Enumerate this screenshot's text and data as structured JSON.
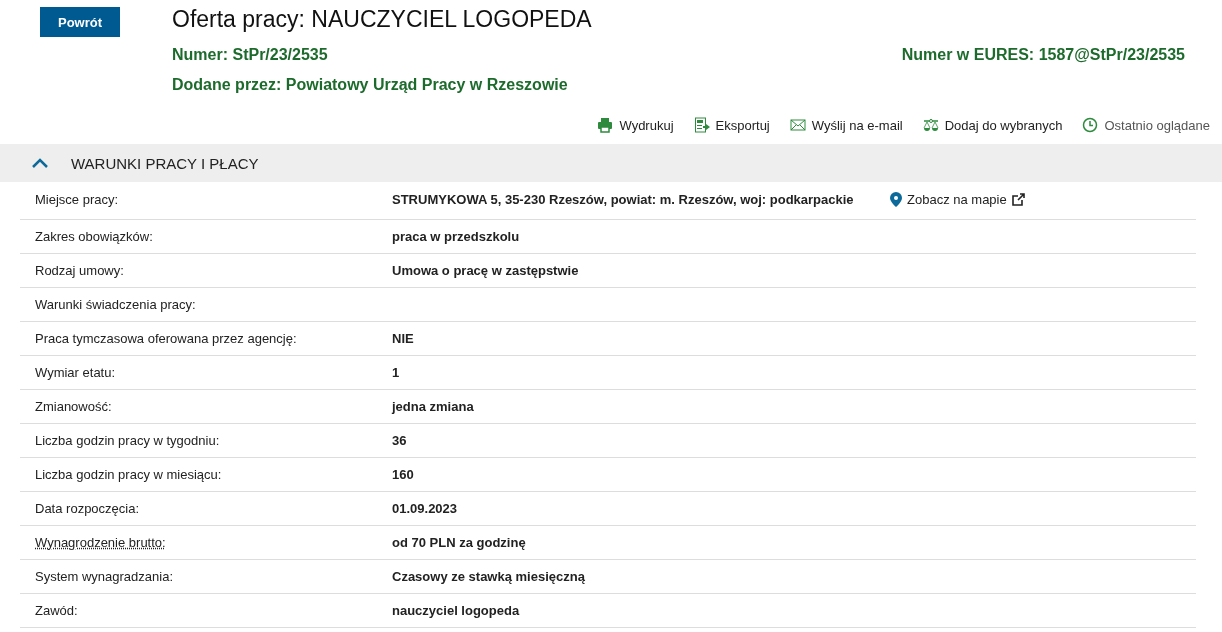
{
  "back_button": "Powrót",
  "title": "Oferta pracy: NAUCZYCIEL LOGOPEDA",
  "number": {
    "label": "Numer:",
    "value": "StPr/23/2535"
  },
  "eures_number": {
    "label": "Numer w EURES:",
    "value": "1587@StPr/23/2535"
  },
  "added_by": {
    "label": "Dodane przez:",
    "value": "Powiatowy Urząd Pracy w Rzeszowie"
  },
  "actions": [
    {
      "kind": "print",
      "label": "Wydrukuj"
    },
    {
      "kind": "pdf",
      "label": "Eksportuj"
    },
    {
      "kind": "mail",
      "label": "Wyślij na e-mail"
    },
    {
      "kind": "favorite",
      "label": "Dodaj do wybranych"
    },
    {
      "kind": "history",
      "label": "Ostatnio oglądane"
    }
  ],
  "section": {
    "title": "WARUNKI PRACY I PŁACY",
    "expanded": true,
    "rows": [
      {
        "label": "Miejsce pracy:",
        "value": "STRUMYKOWA 5, 35-230 Rzeszów, powiat: m. Rzeszów, woj: podkarpackie",
        "link": "Zobacz na mapie"
      },
      {
        "label": "Zakres obowiązków:",
        "value": "praca w przedszkolu"
      },
      {
        "label": "Rodzaj umowy:",
        "value": "Umowa o pracę w zastępstwie"
      },
      {
        "label": "Warunki świadczenia pracy:"
      },
      {
        "label": "Praca tymczasowa oferowana przez agencję:",
        "value": "NIE"
      },
      {
        "label": "Wymiar etatu:",
        "value": "1"
      },
      {
        "label": "Zmianowość:",
        "value": "jedna zmiana"
      },
      {
        "label": "Liczba godzin pracy w tygodniu:",
        "value": "36"
      },
      {
        "label": "Liczba godzin pracy w miesiącu:",
        "value": "160"
      },
      {
        "label": "Data rozpoczęcia:",
        "value": "01.09.2023"
      },
      {
        "label": "Wynagrodzenie brutto:",
        "value": "od 70 PLN za godzinę",
        "hint": true
      },
      {
        "label": "System wynagradzania:",
        "value": "Czasowy ze stawką miesięczną"
      },
      {
        "label": "Zawód:",
        "value": "nauczyciel logopeda"
      }
    ]
  }
}
